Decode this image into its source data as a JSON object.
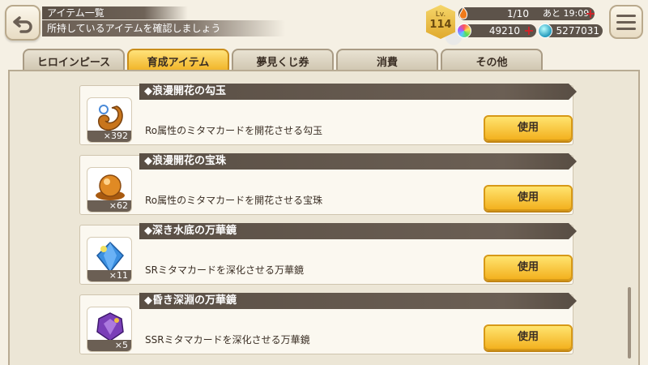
{
  "header": {
    "title": "アイテム一覧",
    "subtitle": "所持しているアイテムを確認しましょう"
  },
  "status": {
    "level_label": "Lv.",
    "level": "114",
    "ap": "1/10",
    "ap_timer": "あと 19:09",
    "currency1": "49210",
    "currency2": "5277031"
  },
  "tabs": [
    {
      "label": "ヒロインピース",
      "active": false
    },
    {
      "label": "育成アイテム",
      "active": true
    },
    {
      "label": "夢見くじ券",
      "active": false
    },
    {
      "label": "消費",
      "active": false
    },
    {
      "label": "その他",
      "active": false
    }
  ],
  "items": [
    {
      "name": "◆浪漫開花の勾玉",
      "description": "Ro属性のミタマカードを開花させる勾玉",
      "quantity": "×392",
      "button": "使用",
      "icon": "magatama-icon",
      "color": "#c8751c"
    },
    {
      "name": "◆浪漫開花の宝珠",
      "description": "Ro属性のミタマカードを開花させる宝珠",
      "quantity": "×62",
      "button": "使用",
      "icon": "orb-icon",
      "color": "#d48220"
    },
    {
      "name": "◆深き水底の万華鏡",
      "description": "SRミタマカードを深化させる万華鏡",
      "quantity": "×11",
      "button": "使用",
      "icon": "blue-crystal-icon",
      "color": "#3b8fe0"
    },
    {
      "name": "◆昏き深淵の万華鏡",
      "description": "SSRミタマカードを深化させる万華鏡",
      "quantity": "×5",
      "button": "使用",
      "icon": "purple-crystal-icon",
      "color": "#7a3fb8"
    }
  ]
}
